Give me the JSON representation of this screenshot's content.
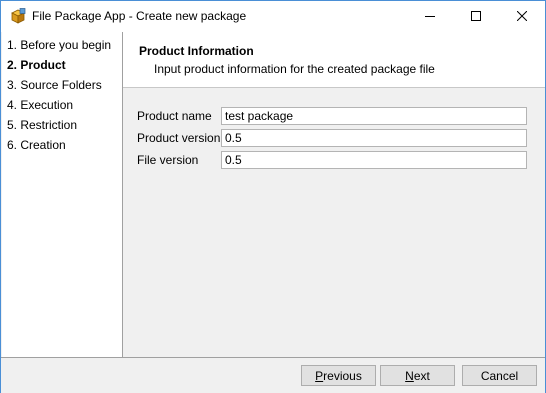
{
  "window": {
    "title": "File Package App - Create new package",
    "icon": "package-icon"
  },
  "steps": [
    {
      "label": "1. Before you begin",
      "active": false
    },
    {
      "label": "2. Product",
      "active": true
    },
    {
      "label": "3. Source Folders",
      "active": false
    },
    {
      "label": "4. Execution",
      "active": false
    },
    {
      "label": "5. Restriction",
      "active": false
    },
    {
      "label": "6. Creation",
      "active": false
    }
  ],
  "header": {
    "title": "Product Information",
    "subtitle": "Input product information for the created package file"
  },
  "form": {
    "product_name": {
      "label": "Product name",
      "value": "test package"
    },
    "product_version": {
      "label": "Product version",
      "value": "0.5"
    },
    "file_version": {
      "label": "File version",
      "value": "0.5"
    }
  },
  "buttons": {
    "previous": {
      "accel": "P",
      "rest": "revious"
    },
    "next": {
      "accel": "N",
      "rest": "ext"
    },
    "cancel": "Cancel"
  }
}
